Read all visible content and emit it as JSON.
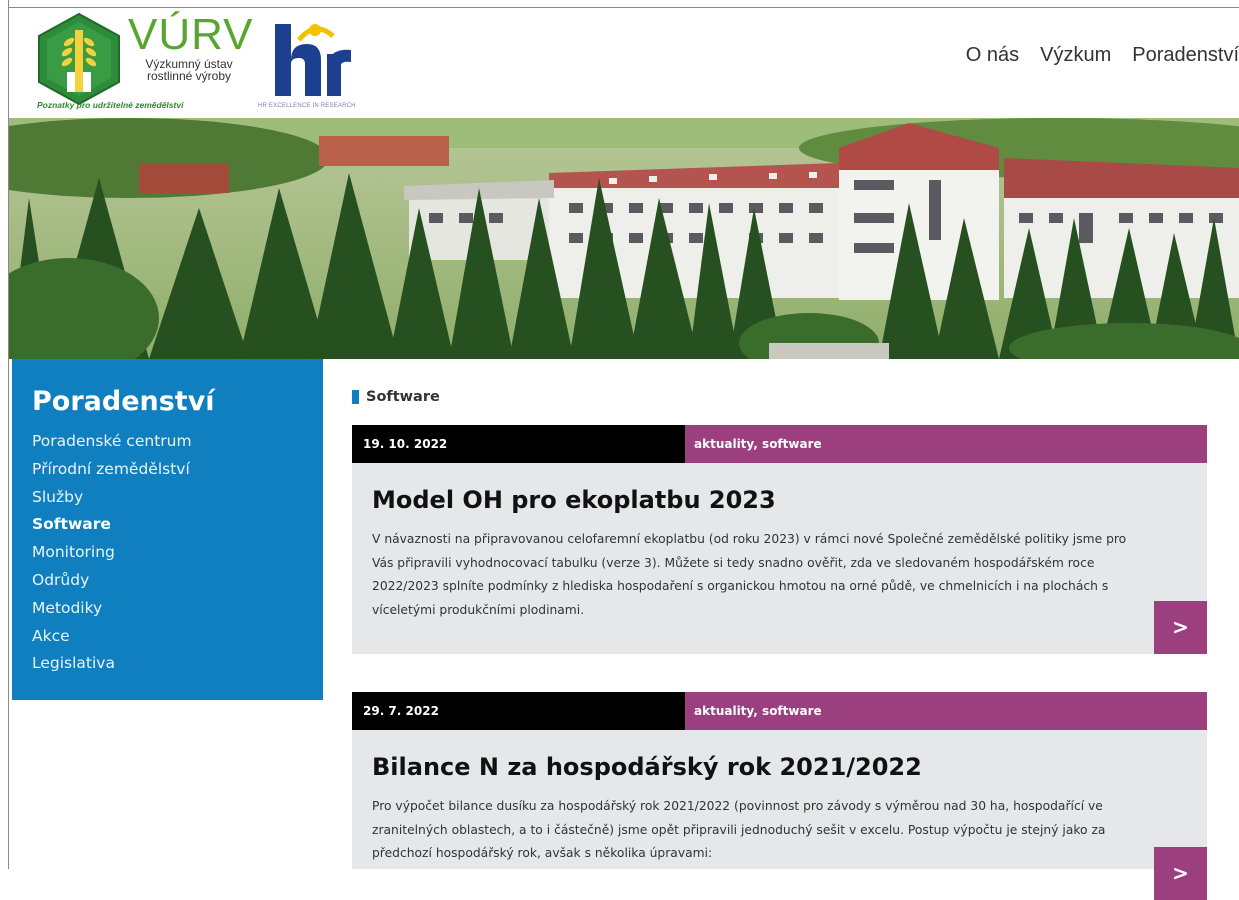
{
  "header": {
    "logo_title": "VÚRV",
    "logo_subtitle": "Výzkumný ústav rostlinné výroby",
    "logo_tagline": "Poznatky pro udržitelné zemědělství",
    "hr_caption": "HR EXCELLENCE IN RESEARCH",
    "nav": [
      "O nás",
      "Výzkum",
      "Poradenství"
    ]
  },
  "sidebar": {
    "title": "Poradenství",
    "items": [
      {
        "label": "Poradenské centrum"
      },
      {
        "label": "Přírodní zemědělství"
      },
      {
        "label": "Služby"
      },
      {
        "label": "Software",
        "active": true
      },
      {
        "label": "Monitoring"
      },
      {
        "label": "Odrůdy"
      },
      {
        "label": "Metodiky"
      },
      {
        "label": "Akce"
      },
      {
        "label": "Legislativa"
      }
    ]
  },
  "main": {
    "section_title": "Software",
    "articles": [
      {
        "date": "19. 10. 2022",
        "tags": "aktuality, software",
        "title": "Model OH pro ekoplatbu 2023",
        "text": "V návaznosti na připravovanou celofaremní ekoplatbu (od roku 2023) v rámci nové Společné zemědělské politiky jsme pro Vás připravili vyhodnocovací tabulku (verze 3). Můžete si tedy snadno ověřit, zda ve sledovaném hospodářském roce 2022/2023 splníte podmínky z hlediska hospodaření s organickou hmotou na orné půdě, ve chmelnicích i na plochách s víceletými produkčními plodinami.",
        "arrow": ">"
      },
      {
        "date": "29. 7. 2022",
        "tags": "aktuality, software",
        "title": "Bilance N za hospodářský rok 2021/2022",
        "text": "Pro výpočet bilance dusíku za hospodářský rok 2021/2022 (povinnost pro závody s výměrou nad 30 ha, hospodařící ve zranitelných oblastech, a to i částečně) jsme opět připravili jednoduchý sešit v excelu. Postup výpočtu je stejný jako za předchozí hospodářský rok, avšak s několika úpravami:",
        "arrow": ">"
      }
    ]
  },
  "colors": {
    "sidebar_bg": "#0f7fbf",
    "accent_purple": "#9b3f7e",
    "logo_green": "#58a531",
    "card_bg": "#e6e7e8"
  },
  "icons": {
    "logo": "vurv-wheat-hexagon-logo",
    "hr_logo": "hr-excellence-logo",
    "arrow": "chevron-right-icon"
  }
}
